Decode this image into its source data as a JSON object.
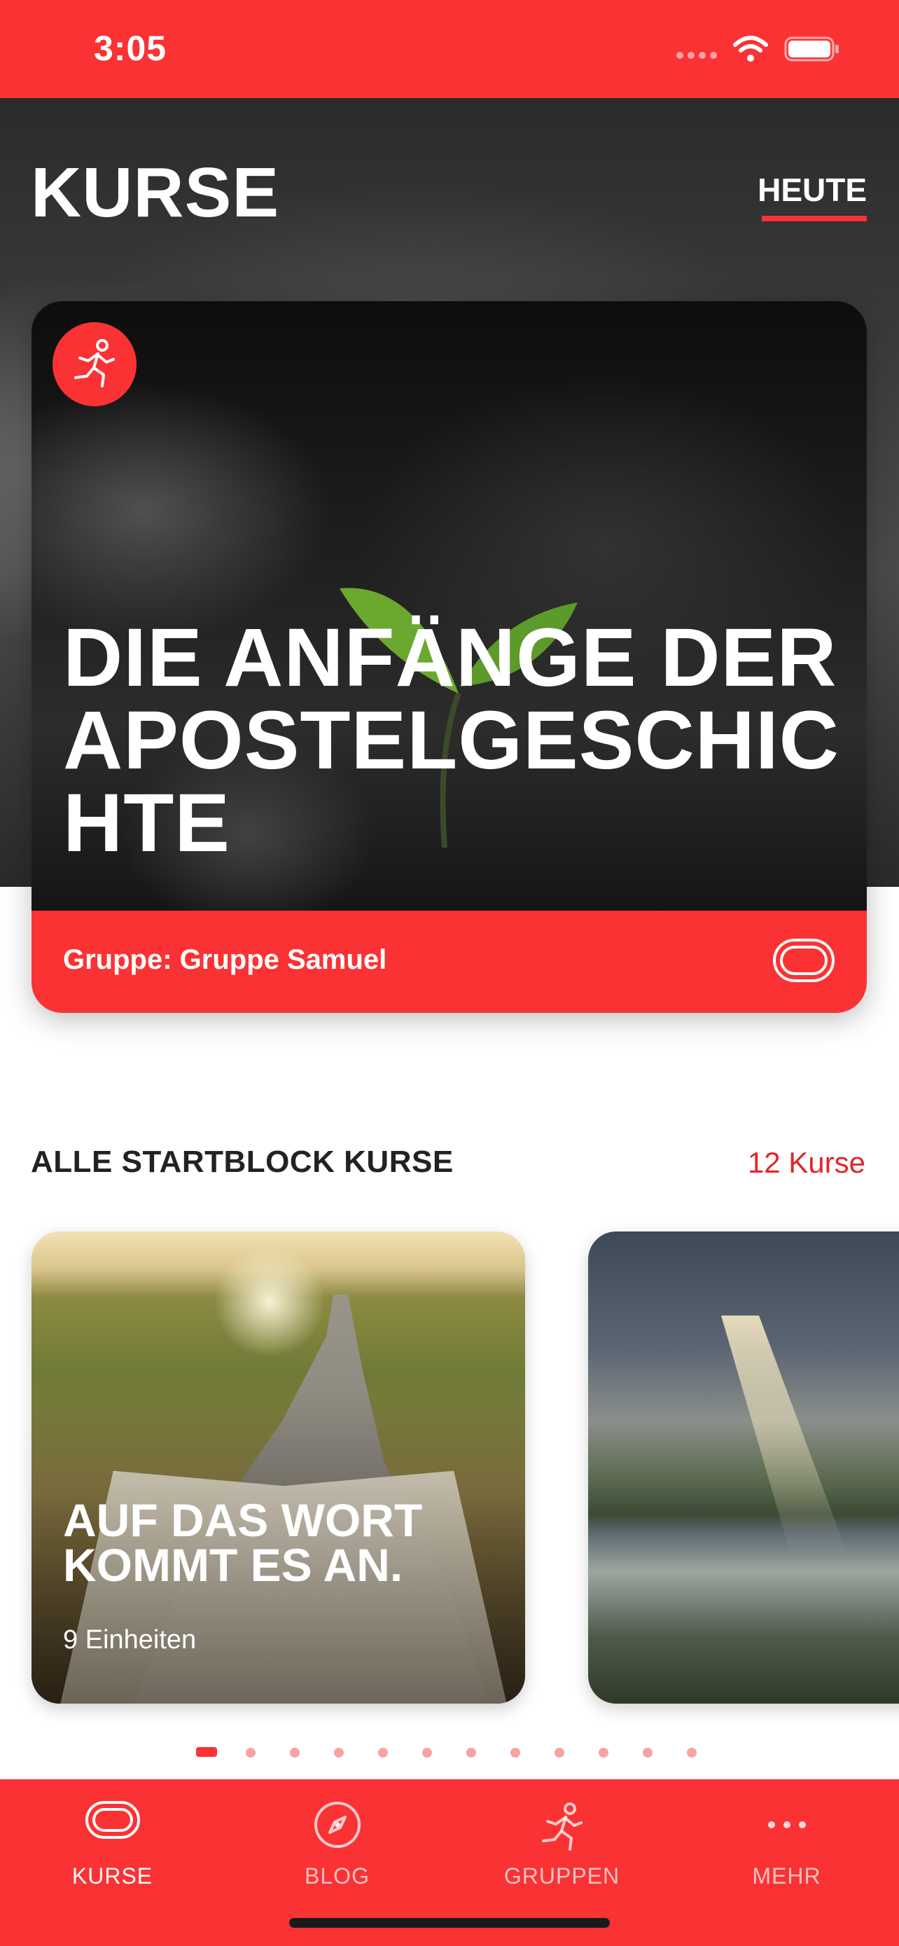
{
  "status_bar": {
    "time": "3:05"
  },
  "header": {
    "title": "KURSE",
    "active_tab": "HEUTE"
  },
  "featured_course": {
    "title": "DIE ANFÄNGE DER APOSTELGESCHICHTE",
    "group": "Gruppe: Gruppe Samuel",
    "badge_icon": "runner-icon",
    "footer_icon": "track-icon"
  },
  "section": {
    "title": "ALLE STARTBLOCK KURSE",
    "count": "12 Kurse"
  },
  "courses": [
    {
      "title": "AUF DAS WORT KOMMT ES AN.",
      "meta": "9 Einheiten"
    },
    {
      "title": "",
      "meta": ""
    }
  ],
  "pager": {
    "total": 12,
    "active": 0
  },
  "tab_bar": {
    "items": [
      {
        "label": "KURSE",
        "icon": "track-icon",
        "active": true
      },
      {
        "label": "BLOG",
        "icon": "compass-icon",
        "active": false
      },
      {
        "label": "GRUPPEN",
        "icon": "runner-icon",
        "active": false
      },
      {
        "label": "MEHR",
        "icon": "more-icon",
        "active": false
      }
    ]
  },
  "colors": {
    "accent": "#fa3234",
    "accent_text": "#e2262a"
  }
}
